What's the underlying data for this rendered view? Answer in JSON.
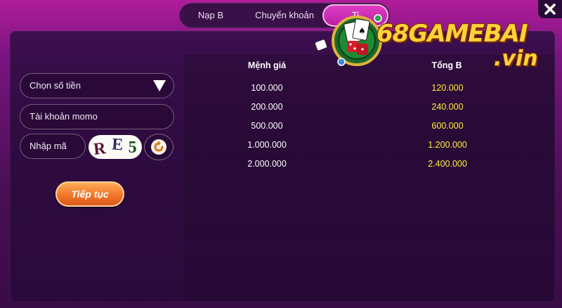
{
  "tabs": [
    {
      "label": "Nạp B"
    },
    {
      "label": "Chuyển khoản"
    },
    {
      "label": "Ti"
    }
  ],
  "logo": {
    "main": "68GAMEBAI",
    "sub": ".vin"
  },
  "form": {
    "amount_select": "Chọn số tiền",
    "account_field": "Tài khoản momo",
    "code_field": "Nhập mã",
    "captcha": [
      "R",
      "E",
      "5"
    ],
    "continue_label": "Tiếp tục"
  },
  "table": {
    "headers": [
      "Mệnh giá",
      "Tổng B"
    ],
    "rows": [
      [
        "100.000",
        "120.000"
      ],
      [
        "200.000",
        "240.000"
      ],
      [
        "500.000",
        "600.000"
      ],
      [
        "1.000.000",
        "1.200.000"
      ],
      [
        "2.000.000",
        "2.400.000"
      ]
    ]
  },
  "colors": {
    "accent": "#b61ea3",
    "value_yellow": "#ffee3a",
    "button_orange": "#f0762a"
  },
  "icons": {
    "close": "close-icon",
    "dropdown": "triangle-down-icon",
    "refresh": "refresh-icon"
  }
}
